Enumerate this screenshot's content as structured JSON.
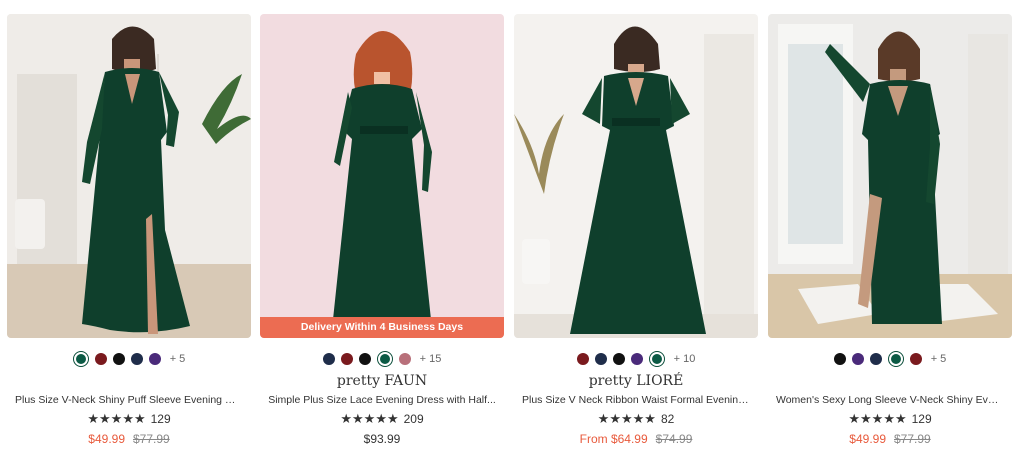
{
  "colors": {
    "accent_sale": "#e85a3c",
    "banner_bg": "#ec6c52",
    "dress_green": "#0f3f2c"
  },
  "products": [
    {
      "swatches": [
        "#0c5a45",
        "#7a1a1e",
        "#111111",
        "#1f2d4a",
        "#4a2a7a"
      ],
      "selected_swatch": 0,
      "more_colors": "+ 5",
      "brand": "",
      "title": "Plus Size V-Neck Shiny Puff Sleeve Evening Dres...",
      "rating_stars": 5,
      "rating_count": "129",
      "price": "$49.99",
      "price_style": "sale",
      "original_price": "$77.99"
    },
    {
      "swatches": [
        "#1f2d4a",
        "#7a1a1e",
        "#111111",
        "#0c5a45",
        "#b8707a"
      ],
      "selected_swatch": 3,
      "more_colors": "+ 15",
      "brand": "pretty FAUN",
      "title": "Simple Plus Size Lace Evening Dress with Half...",
      "rating_stars": 5,
      "rating_count": "209",
      "price": "$93.99",
      "price_style": "regular",
      "original_price": "",
      "banner": "Delivery Within 4 Business Days"
    },
    {
      "swatches": [
        "#7a1a1e",
        "#1f2d4a",
        "#111111",
        "#4a2a7a",
        "#0c5a45"
      ],
      "selected_swatch": 4,
      "more_colors": "+ 10",
      "brand": "pretty LIORÉ",
      "title": "Plus Size V Neck Ribbon Waist Formal Evening...",
      "rating_stars": 5,
      "rating_count": "82",
      "price": "From $64.99",
      "price_style": "sale",
      "original_price": "$74.99"
    },
    {
      "swatches": [
        "#111111",
        "#4a2a7a",
        "#1f2d4a",
        "#0c5a45",
        "#7a1a1e"
      ],
      "selected_swatch": 3,
      "more_colors": "+ 5",
      "brand": "",
      "title": "Women's Sexy Long Sleeve V-Neck Shiny Eveni...",
      "rating_stars": 5,
      "rating_count": "129",
      "price": "$49.99",
      "price_style": "sale",
      "original_price": "$77.99"
    }
  ]
}
